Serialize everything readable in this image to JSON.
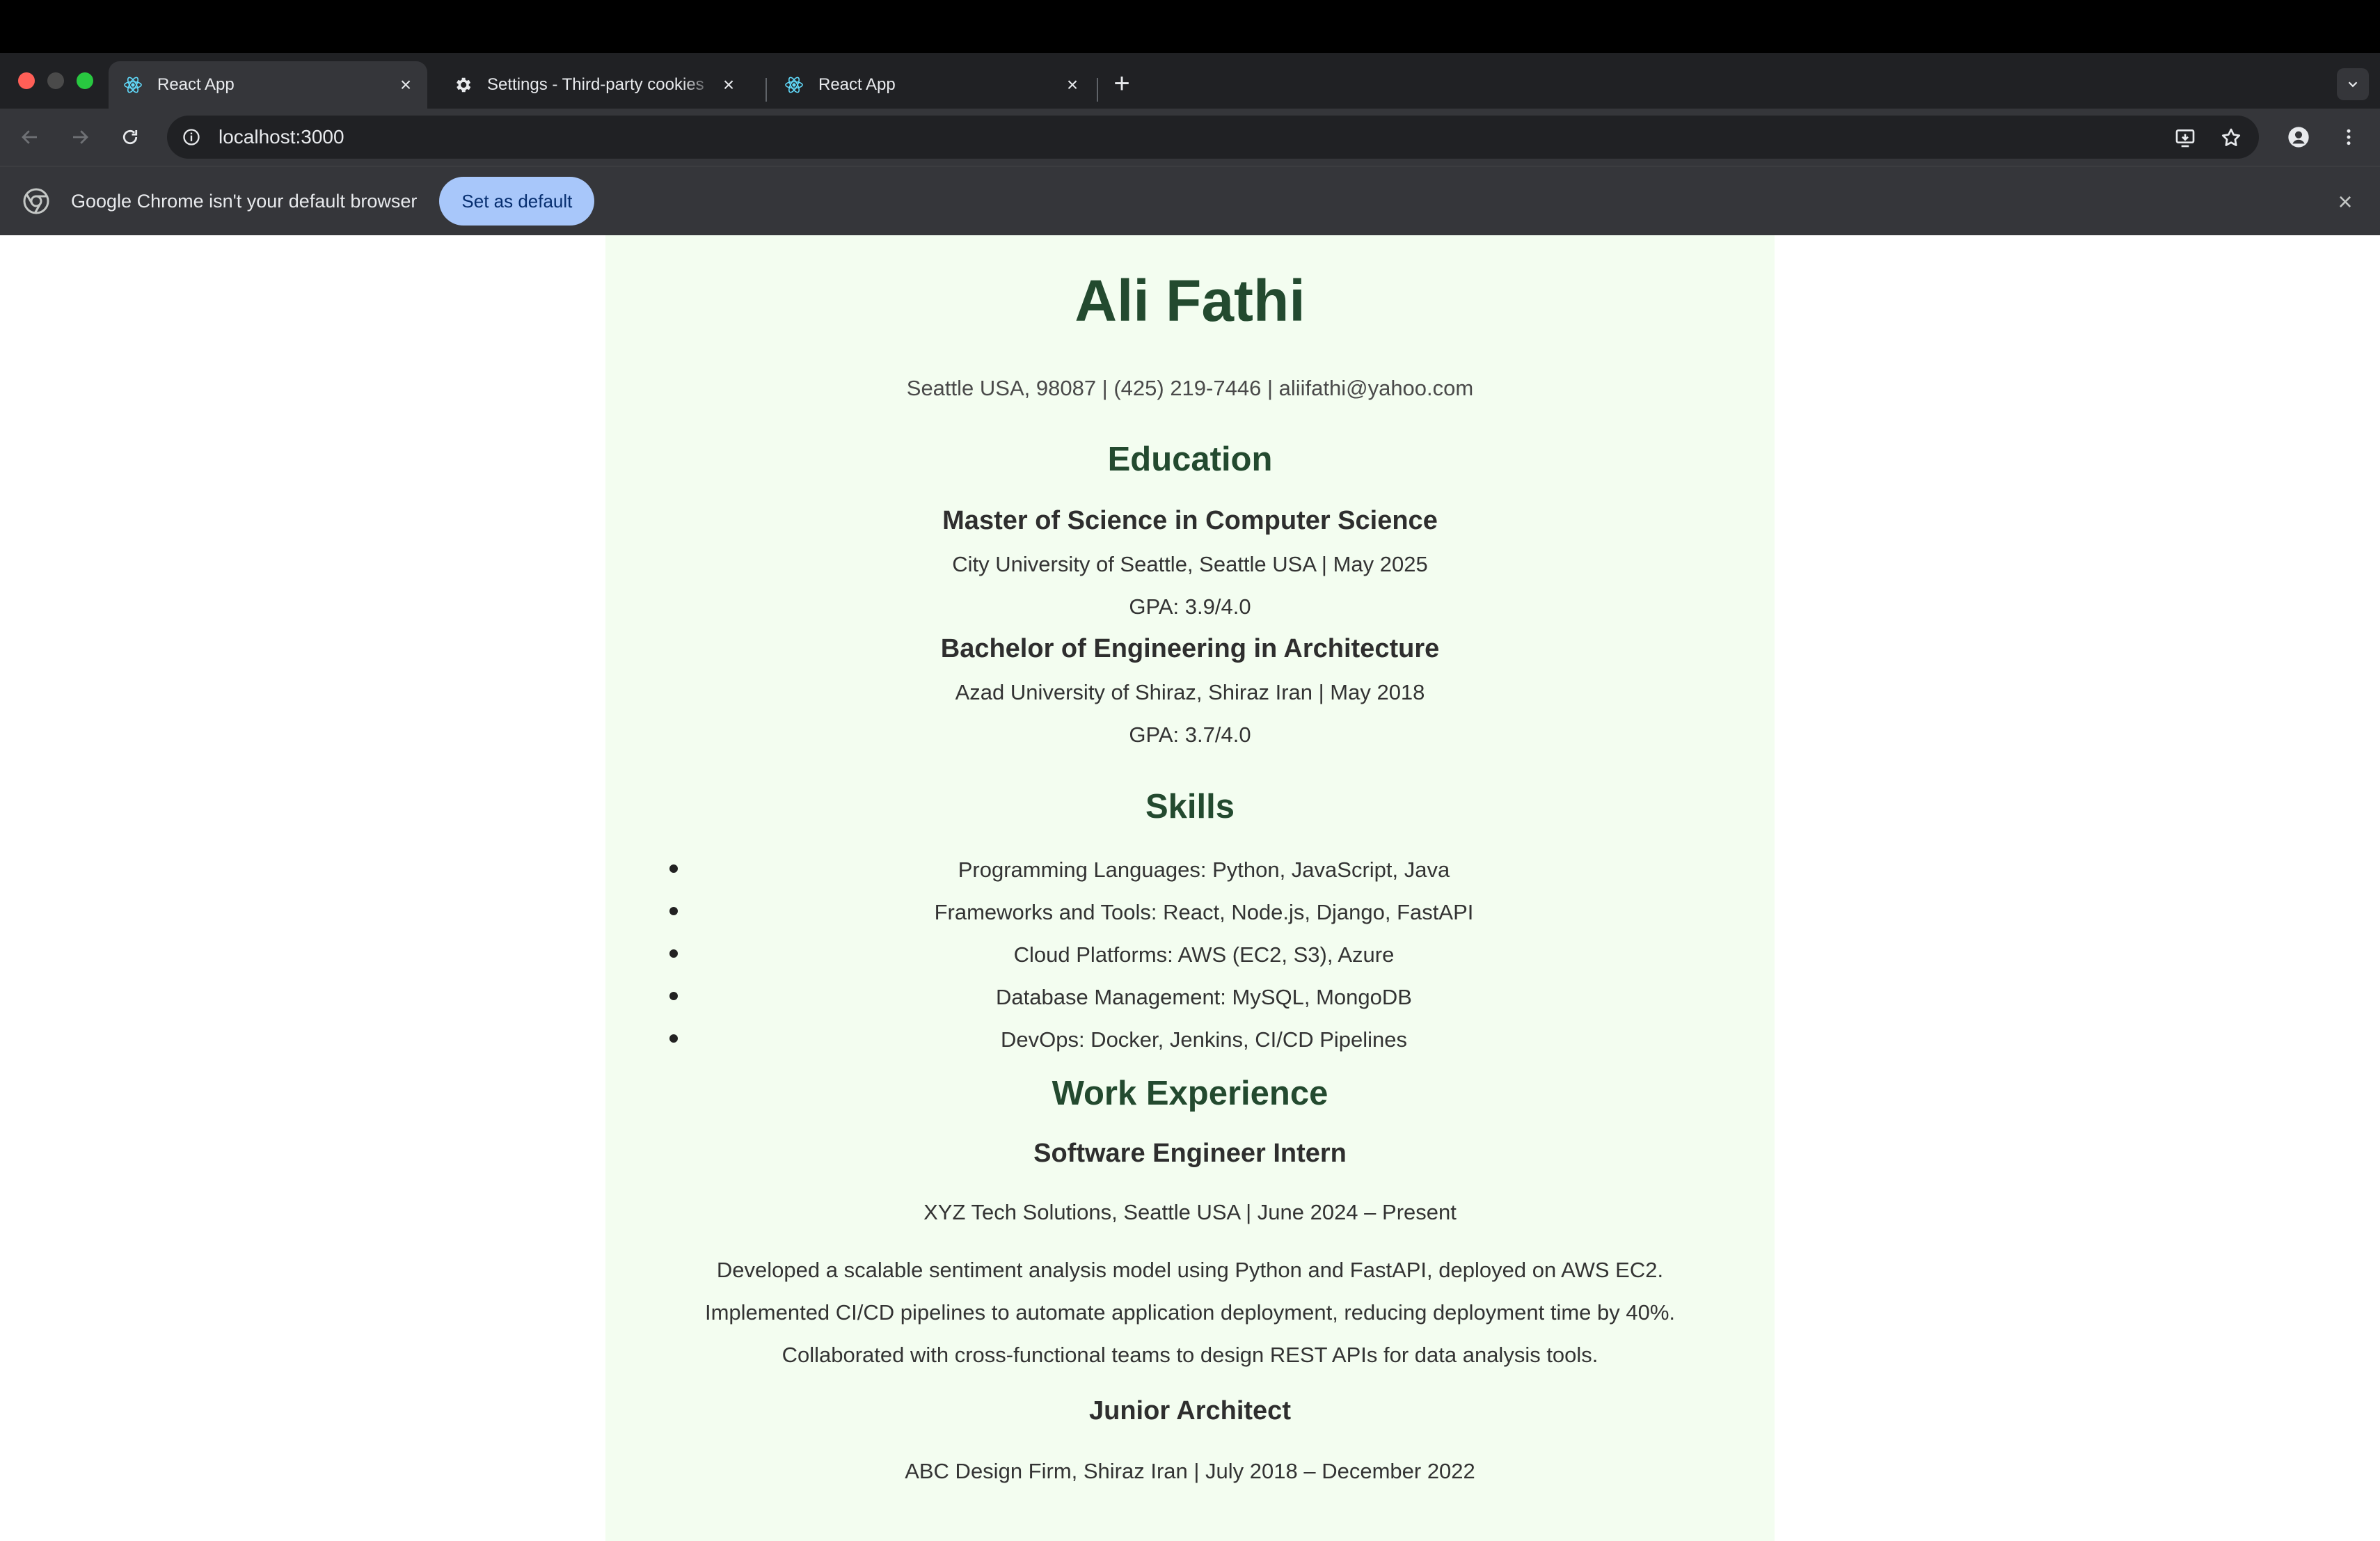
{
  "browser": {
    "tabs": [
      {
        "title": "React App",
        "icon": "react-icon",
        "active": true
      },
      {
        "title": "Settings - Third-party cookies",
        "icon": "gear-icon",
        "active": false
      },
      {
        "title": "React App",
        "icon": "react-icon",
        "active": false
      }
    ],
    "url": "localhost:3000",
    "infobar": {
      "message": "Google Chrome isn't your default browser",
      "button": "Set as default"
    }
  },
  "resume": {
    "name": "Ali Fathi",
    "contact": "Seattle USA, 98087 | (425) 219-7446 | aliifathi@yahoo.com",
    "education": {
      "heading": "Education",
      "entries": [
        {
          "degree": "Master of Science in Computer Science",
          "school": "City University of Seattle, Seattle USA | May 2025",
          "gpa": "GPA: 3.9/4.0"
        },
        {
          "degree": "Bachelor of Engineering in Architecture",
          "school": "Azad University of Shiraz, Shiraz Iran | May 2018",
          "gpa": "GPA: 3.7/4.0"
        }
      ]
    },
    "skills": {
      "heading": "Skills",
      "items": [
        "Programming Languages: Python, JavaScript, Java",
        "Frameworks and Tools: React, Node.js, Django, FastAPI",
        "Cloud Platforms: AWS (EC2, S3), Azure",
        "Database Management: MySQL, MongoDB",
        "DevOps: Docker, Jenkins, CI/CD Pipelines"
      ]
    },
    "experience": {
      "heading": "Work Experience",
      "jobs": [
        {
          "title": "Software Engineer Intern",
          "company": "XYZ Tech Solutions, Seattle USA | June 2024 – Present",
          "details": [
            "Developed a scalable sentiment analysis model using Python and FastAPI, deployed on AWS EC2.",
            "Implemented CI/CD pipelines to automate application deployment, reducing deployment time by 40%.",
            "Collaborated with cross-functional teams to design REST APIs for data analysis tools."
          ]
        },
        {
          "title": "Junior Architect",
          "company": "ABC Design Firm, Shiraz Iran | July 2018 – December 2022"
        }
      ]
    }
  }
}
